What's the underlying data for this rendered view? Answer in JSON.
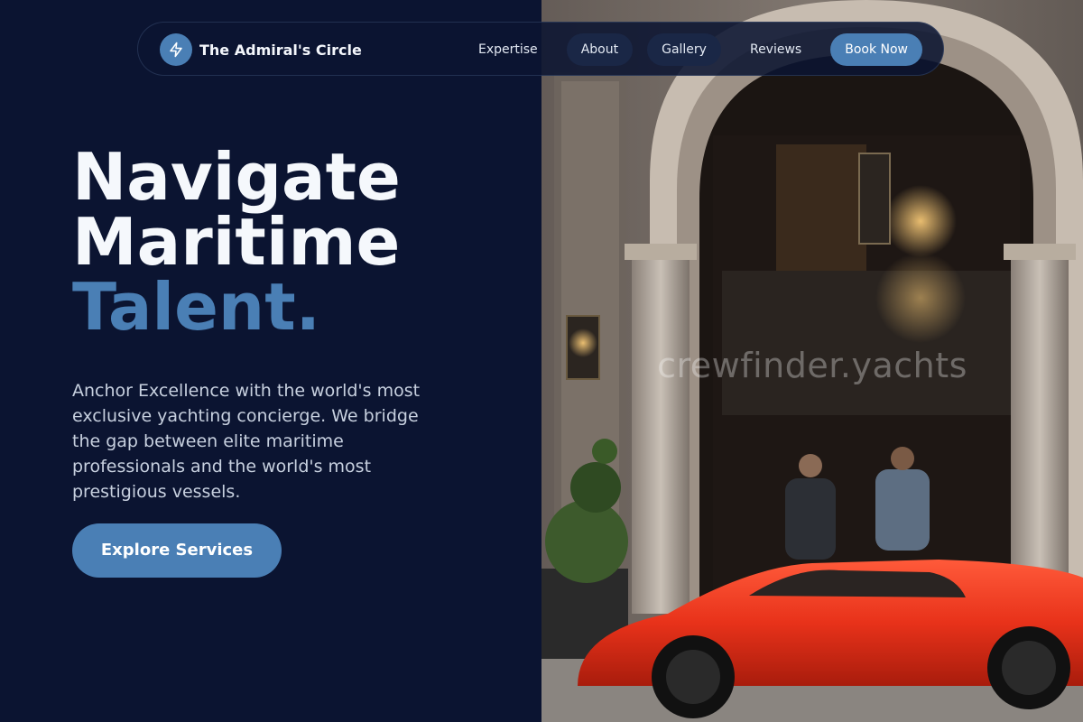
{
  "brand": {
    "name": "The Admiral's Circle",
    "logo_icon": "lightning-bolt-icon"
  },
  "nav": {
    "items": [
      {
        "label": "Expertise"
      },
      {
        "label": "About"
      },
      {
        "label": "Gallery"
      },
      {
        "label": "Reviews"
      }
    ],
    "cta_label": "Book Now"
  },
  "hero": {
    "headline_line1": "Navigate",
    "headline_line2": "Maritime",
    "headline_accent": "Talent.",
    "description": "Anchor Excellence with the world's most exclusive yachting concierge. We bridge the gap between elite maritime professionals and the world's most prestigious vessels.",
    "cta_label": "Explore Services"
  },
  "image": {
    "watermark": "crewfinder.yachts",
    "subject": "red sports car parked outside ornate arched building entrance"
  },
  "colors": {
    "background": "#0b1431",
    "accent": "#4a7fb5",
    "headline": "#f5f8fc",
    "body_text": "#c7d0df",
    "nav_pill": "#1a2746"
  }
}
